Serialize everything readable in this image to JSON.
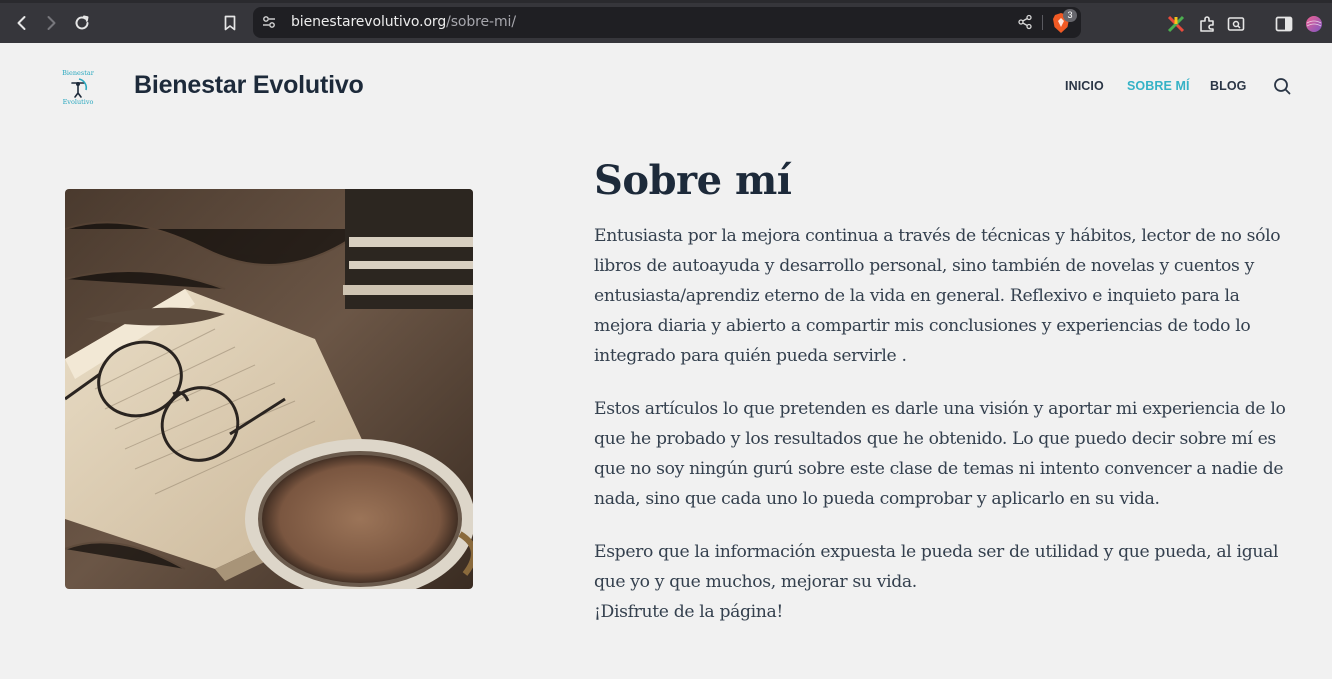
{
  "browser": {
    "url_domain": "bienestarevolutivo.org",
    "url_path": "/sobre-mi/",
    "shield_count": "3"
  },
  "site": {
    "title": "Bienestar Evolutivo",
    "logo_text_top": "Bienestar",
    "logo_text_bottom": "Evolutivo"
  },
  "nav": {
    "items": [
      {
        "label": "INICIO",
        "active": false
      },
      {
        "label": "SOBRE MÍ",
        "active": true
      },
      {
        "label": "BLOG",
        "active": false
      }
    ]
  },
  "page": {
    "title": "Sobre mí",
    "paragraphs": [
      "Entusiasta por la mejora continua a través de técnicas y hábitos, lector de no sólo libros de autoayuda y desarrollo personal, sino también de novelas y cuentos y entusiasta/aprendiz eterno de la vida en general. Reflexivo e inquieto para la mejora diaria y abierto a compartir mis conclusiones y experiencias de todo lo integrado para quién pueda servirle .",
      "Estos artículos lo que pretenden es darle una visión y aportar mi experiencia de lo que he probado y los resultados que he obtenido. Lo que puedo decir sobre mí es que no soy ningún gurú sobre este clase de temas ni intento convencer a nadie de nada, sino que cada uno lo pueda comprobar y aplicarlo en su vida.",
      "Espero que la información expuesta le pueda ser de utilidad y que pueda, al igual que yo y que muchos, mejorar su vida."
    ],
    "closing": "¡Disfrute de la página!"
  },
  "colors": {
    "accent": "#35b2c6",
    "heading": "#1d2a3a",
    "body_text": "#34404e",
    "background": "#f1f1f1"
  }
}
